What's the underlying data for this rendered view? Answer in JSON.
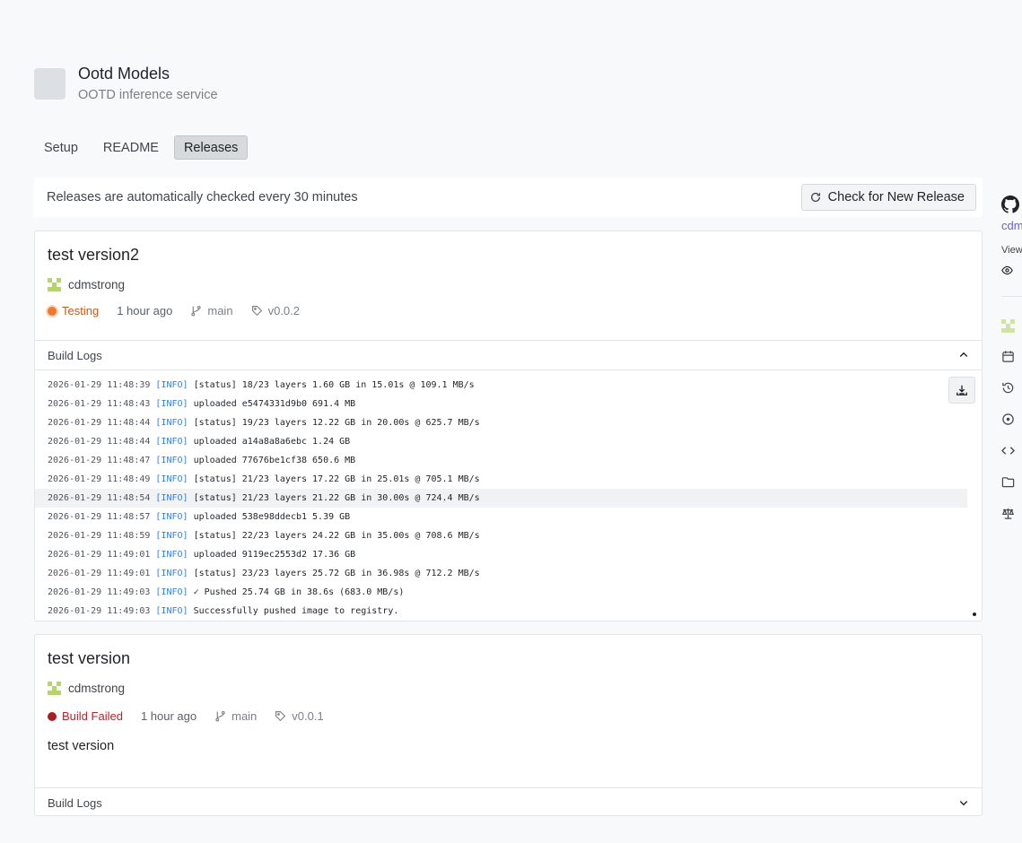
{
  "app": {
    "title": "Ootd Models",
    "subtitle": "OOTD inference service"
  },
  "tabs": [
    {
      "label": "Setup",
      "active": false
    },
    {
      "label": "README",
      "active": false
    },
    {
      "label": "Releases",
      "active": true
    }
  ],
  "notice": {
    "text": "Releases are automatically checked every 30 minutes",
    "button_label": "Check for New Release"
  },
  "releases": [
    {
      "title": "test version2",
      "author": "cdmstrong",
      "status": "Testing",
      "time": "1 hour ago",
      "branch": "main",
      "tag": "v0.0.2",
      "logs_label": "Build Logs",
      "logs_expanded": true,
      "logs": [
        {
          "ts": "2026-01-29 11:48:39",
          "lvl": "[INFO]",
          "msg": "[status] 18/23 layers 1.60 GB in 15.01s @ 109.1 MB/s"
        },
        {
          "ts": "2026-01-29 11:48:43",
          "lvl": "[INFO]",
          "msg": "uploaded e5474331d9b0 691.4 MB"
        },
        {
          "ts": "2026-01-29 11:48:44",
          "lvl": "[INFO]",
          "msg": "[status] 19/23 layers 12.22 GB in 20.00s @ 625.7 MB/s"
        },
        {
          "ts": "2026-01-29 11:48:44",
          "lvl": "[INFO]",
          "msg": "uploaded a14a8a8a6ebc 1.24 GB"
        },
        {
          "ts": "2026-01-29 11:48:47",
          "lvl": "[INFO]",
          "msg": "uploaded 77676be1cf38 650.6 MB"
        },
        {
          "ts": "2026-01-29 11:48:49",
          "lvl": "[INFO]",
          "msg": "[status] 21/23 layers 17.22 GB in 25.01s @ 705.1 MB/s"
        },
        {
          "ts": "2026-01-29 11:48:54",
          "lvl": "[INFO]",
          "msg": "[status] 21/23 layers 21.22 GB in 30.00s @ 724.4 MB/s"
        },
        {
          "ts": "2026-01-29 11:48:57",
          "lvl": "[INFO]",
          "msg": "uploaded 538e98ddecb1 5.39 GB"
        },
        {
          "ts": "2026-01-29 11:48:59",
          "lvl": "[INFO]",
          "msg": "[status] 22/23 layers 24.22 GB in 35.00s @ 708.6 MB/s"
        },
        {
          "ts": "2026-01-29 11:49:01",
          "lvl": "[INFO]",
          "msg": "uploaded 9119ec2553d2 17.36 GB"
        },
        {
          "ts": "2026-01-29 11:49:01",
          "lvl": "[INFO]",
          "msg": "[status] 23/23 layers 25.72 GB in 36.98s @ 712.2 MB/s"
        },
        {
          "ts": "2026-01-29 11:49:03",
          "lvl": "[INFO]",
          "msg": "✓ Pushed 25.74 GB in 38.6s (683.0 MB/s)"
        },
        {
          "ts": "2026-01-29 11:49:03",
          "lvl": "[INFO]",
          "msg": "Successfully pushed image to registry."
        }
      ]
    },
    {
      "title": "test version",
      "author": "cdmstrong",
      "status": "Build Failed",
      "time": "1 hour ago",
      "branch": "main",
      "tag": "v0.0.1",
      "description": "test version",
      "logs_label": "Build Logs",
      "logs_expanded": false
    }
  ],
  "sidebar": {
    "link_text": "cdm",
    "view_label": "View",
    "icons": [
      "github-icon",
      "eye-icon",
      "avatar",
      "calendar-icon",
      "history-icon",
      "circle-dot-icon",
      "code-icon",
      "folder-icon",
      "scale-icon"
    ]
  },
  "colors": {
    "accent_link": "#6e5ae0",
    "status_testing": "#f0782d",
    "status_failed": "#a81e24",
    "log_level": "#3c7fd0"
  }
}
